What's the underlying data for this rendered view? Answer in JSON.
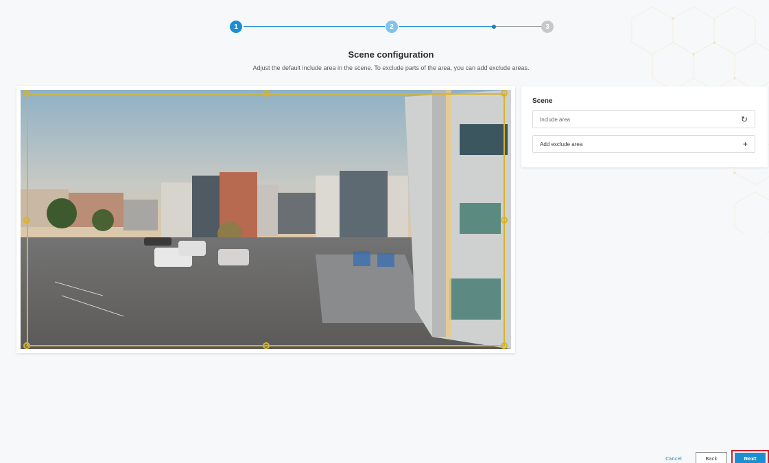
{
  "stepper": {
    "steps": [
      "1",
      "2",
      "3"
    ],
    "active_color": "#1b8fd0",
    "inactive_color": "#c8c8c8"
  },
  "header": {
    "title": "Scene configuration",
    "subtitle": "Adjust the default include area in the scene. To exclude parts of the area, you can add exclude areas."
  },
  "scene_panel": {
    "title": "Scene",
    "include_area_label": "Include area",
    "add_exclude_label": "Add exclude area",
    "reset_icon": "reset-icon",
    "add_icon": "plus-icon"
  },
  "footer": {
    "cancel_label": "Cancel",
    "back_label": "Back",
    "next_label": "Next"
  },
  "colors": {
    "accent": "#1b8fd0",
    "include_frame": "#d9b32a",
    "highlight": "#d21f2a"
  }
}
